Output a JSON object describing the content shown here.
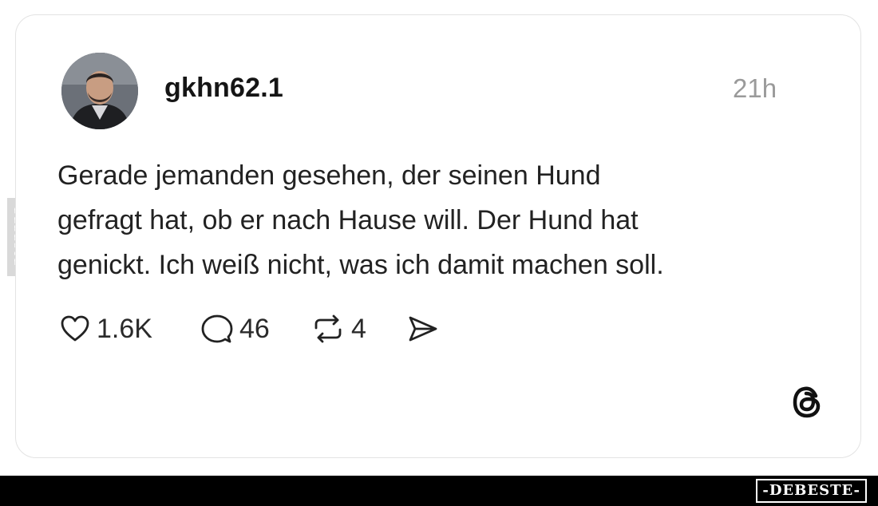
{
  "post": {
    "username": "gkhn62.1",
    "timestamp": "21h",
    "text_lines": [
      "Gerade jemanden gesehen, der seinen Hund",
      "gefragt hat, ob er nach Hause will. Der Hund hat",
      "genickt. Ich weiß nicht, was ich damit machen soll."
    ]
  },
  "actions": {
    "likes": "1.6K",
    "replies": "46",
    "reposts": "4"
  },
  "icons": {
    "like": "heart-icon",
    "reply": "speech-bubble-icon",
    "repost": "repost-icon",
    "share": "send-icon",
    "brand": "threads-logo-icon"
  },
  "watermark": {
    "side": "DEBESTE",
    "bottom": "-DEBESTE-"
  },
  "colors": {
    "background": "#ffffff",
    "card_border": "#e3e3e3",
    "timestamp": "#9a9a9a",
    "text": "#222222",
    "bottom_bar": "#000000"
  }
}
